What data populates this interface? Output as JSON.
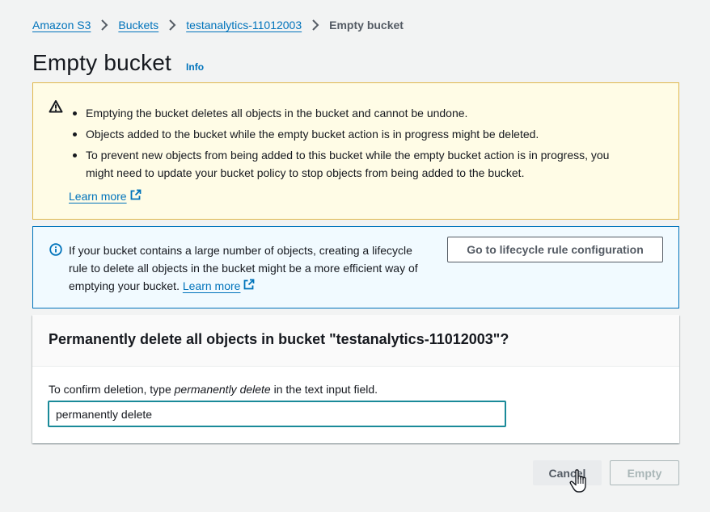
{
  "breadcrumb": {
    "items": [
      "Amazon S3",
      "Buckets",
      "testanalytics-11012003"
    ],
    "current": "Empty bucket"
  },
  "header": {
    "title": "Empty bucket",
    "info": "Info"
  },
  "warning": {
    "bullets": [
      "Emptying the bucket deletes all objects in the bucket and cannot be undone.",
      "Objects added to the bucket while the empty bucket action is in progress might be deleted.",
      "To prevent new objects from being added to this bucket while the empty bucket action is in progress, you might need to update your bucket policy to stop objects from being added to the bucket."
    ],
    "learn_more": "Learn more",
    "color": "#e0b84d"
  },
  "info_alert": {
    "text": "If your bucket contains a large number of objects, creating a lifecycle rule to delete all objects in the bucket might be a more efficient way of emptying your bucket.",
    "learn_more": "Learn more",
    "button": "Go to lifecycle rule configuration",
    "color": "#0073bb"
  },
  "confirm": {
    "title": "Permanently delete all objects in bucket \"testanalytics-11012003\"?",
    "label_before": "To confirm deletion, type ",
    "label_emphasis": "permanently delete",
    "label_after": " in the text input field.",
    "input_value": "permanently delete"
  },
  "actions": {
    "cancel": "Cancel",
    "empty": "Empty"
  },
  "icons": [
    "chevron-right-icon",
    "warning-icon",
    "info-icon",
    "external-link-icon",
    "hand-cursor-icon"
  ]
}
